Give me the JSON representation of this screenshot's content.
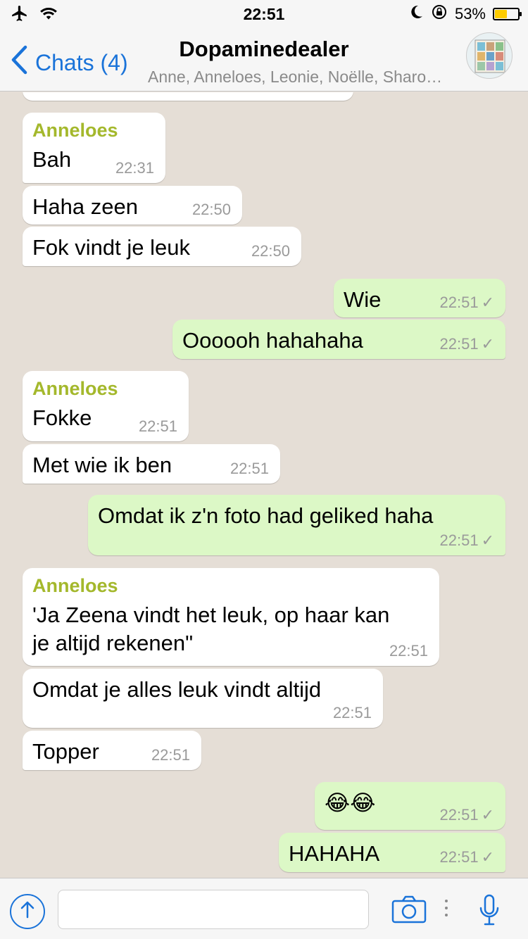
{
  "status_bar": {
    "time": "22:51",
    "battery": "53%",
    "battery_level": 0.53
  },
  "nav": {
    "back_label": "Chats (4)",
    "title": "Dopaminedealer",
    "subtitle": "Anne, Anneloes, Leonie, Noëlle, Sharo…"
  },
  "messages": [
    {
      "dir": "in",
      "sender": "Anneloes",
      "text": "Bah",
      "time": "22:31"
    },
    {
      "dir": "in",
      "text": "Haha zeen",
      "time": "22:50"
    },
    {
      "dir": "in",
      "text": "Fok vindt je leuk",
      "time": "22:50"
    },
    {
      "dir": "out",
      "text": "Wie",
      "time": "22:51"
    },
    {
      "dir": "out",
      "text": "Oooooh hahahaha",
      "time": "22:51"
    },
    {
      "dir": "in",
      "sender": "Anneloes",
      "text": "Fokke",
      "time": "22:51"
    },
    {
      "dir": "in",
      "text": "Met wie ik ben",
      "time": "22:51"
    },
    {
      "dir": "out",
      "text": "Omdat ik z'n foto had geliked haha",
      "time": "22:51"
    },
    {
      "dir": "in",
      "sender": "Anneloes",
      "text": "'Ja Zeena vindt het leuk, op haar kan je altijd rekenen\"",
      "time": "22:51"
    },
    {
      "dir": "in",
      "text": "Omdat je alles leuk vindt altijd",
      "time": "22:51"
    },
    {
      "dir": "in",
      "text": "Topper",
      "time": "22:51"
    },
    {
      "dir": "out",
      "text": "😂😂",
      "time": "22:51"
    },
    {
      "dir": "out",
      "text": "HAHAHA",
      "time": "22:51"
    }
  ],
  "input": {
    "placeholder": ""
  },
  "icons": {
    "airplane": "airplane-icon",
    "wifi": "wifi-icon",
    "moon": "moon-icon",
    "rotation_lock": "rotation-lock-icon",
    "back": "chevron-left-icon",
    "upload": "arrow-up-icon",
    "camera": "camera-icon",
    "mic": "microphone-icon"
  },
  "colors": {
    "accent": "#1a73d9",
    "sender": "#a4b82c",
    "outgoing": "#dcf8c6",
    "incoming": "#ffffff"
  }
}
